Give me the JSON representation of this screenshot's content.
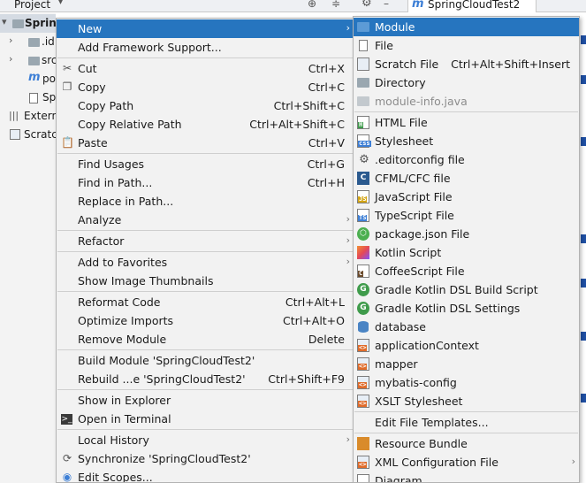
{
  "topbar": {
    "project_label": "Project",
    "tab_label": "SpringCloudTest2"
  },
  "project_tree": [
    {
      "label": "Spring",
      "icon": "folder",
      "arrow": "▾",
      "bold": true
    },
    {
      "label": ".id",
      "icon": "folder",
      "arrow": "›"
    },
    {
      "label": "src",
      "icon": "folder",
      "arrow": "›"
    },
    {
      "label": "po",
      "icon": "m"
    },
    {
      "label": "Sp",
      "icon": "doc"
    },
    {
      "label": "Extern",
      "icon": "bars"
    },
    {
      "label": "Scratc",
      "icon": "scratch"
    }
  ],
  "context_menu": {
    "items": [
      {
        "label": "New",
        "submenu": true
      },
      {
        "label": "Add Framework Support..."
      },
      {
        "label": "Cut",
        "shortcut": "Ctrl+X",
        "icon": "scissors-icon"
      },
      {
        "label": "Copy",
        "shortcut": "Ctrl+C",
        "icon": "copy-icon"
      },
      {
        "label": "Copy Path",
        "shortcut": "Ctrl+Shift+C"
      },
      {
        "label": "Copy Relative Path",
        "shortcut": "Ctrl+Alt+Shift+C"
      },
      {
        "label": "Paste",
        "shortcut": "Ctrl+V",
        "icon": "paste-icon"
      },
      {
        "label": "Find Usages",
        "shortcut": "Ctrl+G"
      },
      {
        "label": "Find in Path...",
        "shortcut": "Ctrl+H"
      },
      {
        "label": "Replace in Path..."
      },
      {
        "label": "Analyze",
        "submenu": true
      },
      {
        "label": "Refactor",
        "submenu": true
      },
      {
        "label": "Add to Favorites",
        "submenu": true
      },
      {
        "label": "Show Image Thumbnails"
      },
      {
        "label": "Reformat Code",
        "shortcut": "Ctrl+Alt+L"
      },
      {
        "label": "Optimize Imports",
        "shortcut": "Ctrl+Alt+O"
      },
      {
        "label": "Remove Module",
        "shortcut": "Delete"
      },
      {
        "label": "Build Module 'SpringCloudTest2'"
      },
      {
        "label": "Rebuild ...e 'SpringCloudTest2'",
        "shortcut": "Ctrl+Shift+F9"
      },
      {
        "label": "Show in Explorer"
      },
      {
        "label": "Open in Terminal",
        "icon": "terminal-icon"
      },
      {
        "label": "Local History",
        "submenu": true
      },
      {
        "label": "Synchronize 'SpringCloudTest2'",
        "icon": "sync-icon"
      },
      {
        "label": "Edit Scopes...",
        "icon": "scope-icon"
      }
    ]
  },
  "new_submenu": {
    "items": [
      {
        "label": "Module",
        "icon": "module-icon",
        "selected": true
      },
      {
        "label": "File",
        "icon": "file-icon"
      },
      {
        "label": "Scratch File",
        "shortcut": "Ctrl+Alt+Shift+Insert",
        "icon": "scratch-file-icon"
      },
      {
        "label": "Directory",
        "icon": "directory-icon"
      },
      {
        "label": "module-info.java",
        "icon": "module-info-icon",
        "disabled": true
      },
      {
        "label": "HTML File",
        "icon": "html-file-icon"
      },
      {
        "label": "Stylesheet",
        "icon": "css-file-icon"
      },
      {
        "label": ".editorconfig file",
        "icon": "editorconfig-icon"
      },
      {
        "label": "CFML/CFC file",
        "icon": "cfml-icon"
      },
      {
        "label": "JavaScript File",
        "icon": "js-file-icon"
      },
      {
        "label": "TypeScript File",
        "icon": "ts-file-icon"
      },
      {
        "label": "package.json File",
        "icon": "package-json-icon"
      },
      {
        "label": "Kotlin Script",
        "icon": "kotlin-icon"
      },
      {
        "label": "CoffeeScript File",
        "icon": "coffeescript-icon"
      },
      {
        "label": "Gradle Kotlin DSL Build Script",
        "icon": "gradle-icon"
      },
      {
        "label": "Gradle Kotlin DSL Settings",
        "icon": "gradle-icon"
      },
      {
        "label": "database",
        "icon": "database-icon"
      },
      {
        "label": "applicationContext",
        "icon": "xml-icon"
      },
      {
        "label": "mapper",
        "icon": "xml-icon"
      },
      {
        "label": "mybatis-config",
        "icon": "xml-icon"
      },
      {
        "label": "XSLT Stylesheet",
        "icon": "xml-icon"
      },
      {
        "label": "Edit File Templates..."
      },
      {
        "label": "Resource Bundle",
        "icon": "resource-bundle-icon"
      },
      {
        "label": "XML Configuration File",
        "icon": "xml-config-icon",
        "submenu": true
      },
      {
        "label": "Diagram",
        "icon": "diagram-icon"
      }
    ]
  },
  "colors": {
    "selection": "#2675bf",
    "menu_bg": "#f2f2f2"
  }
}
